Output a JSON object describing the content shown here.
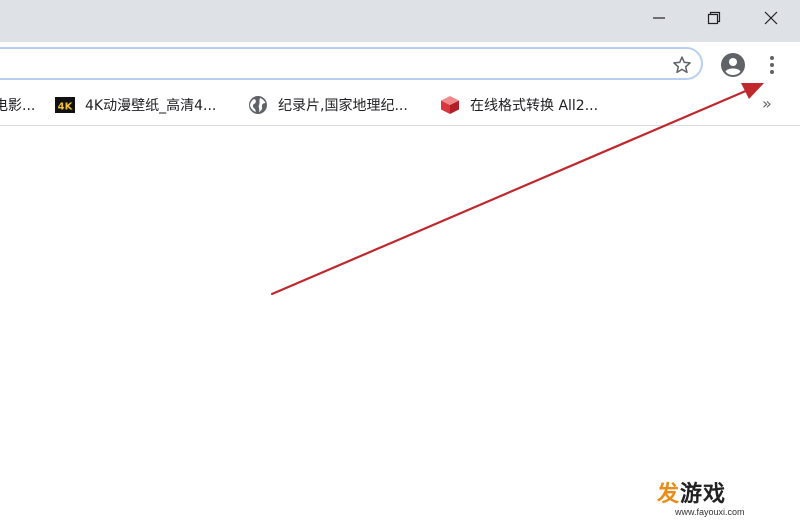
{
  "window_controls": {
    "minimize_icon": "minimize-icon",
    "restore_icon": "restore-icon",
    "close_icon": "close-icon"
  },
  "toolbar": {
    "star_icon": "bookmark-star-icon",
    "profile_icon": "profile-avatar-icon",
    "menu_icon": "kebab-menu-icon"
  },
  "bookmarks": {
    "items": [
      {
        "label": "电影...",
        "icon": "partial-icon"
      },
      {
        "label": "4K动漫壁纸_高清4...",
        "icon": "4k-logo-icon"
      },
      {
        "label": "纪录片,国家地理纪...",
        "icon": "globe-icon"
      },
      {
        "label": "在线格式转换 All2...",
        "icon": "cube-icon"
      }
    ],
    "overflow": "»"
  },
  "annotation": {
    "arrow_color": "#c0282d"
  },
  "watermark": {
    "text_part1": "发",
    "text_part2": "游戏",
    "url": "www.fayouxi.com"
  }
}
